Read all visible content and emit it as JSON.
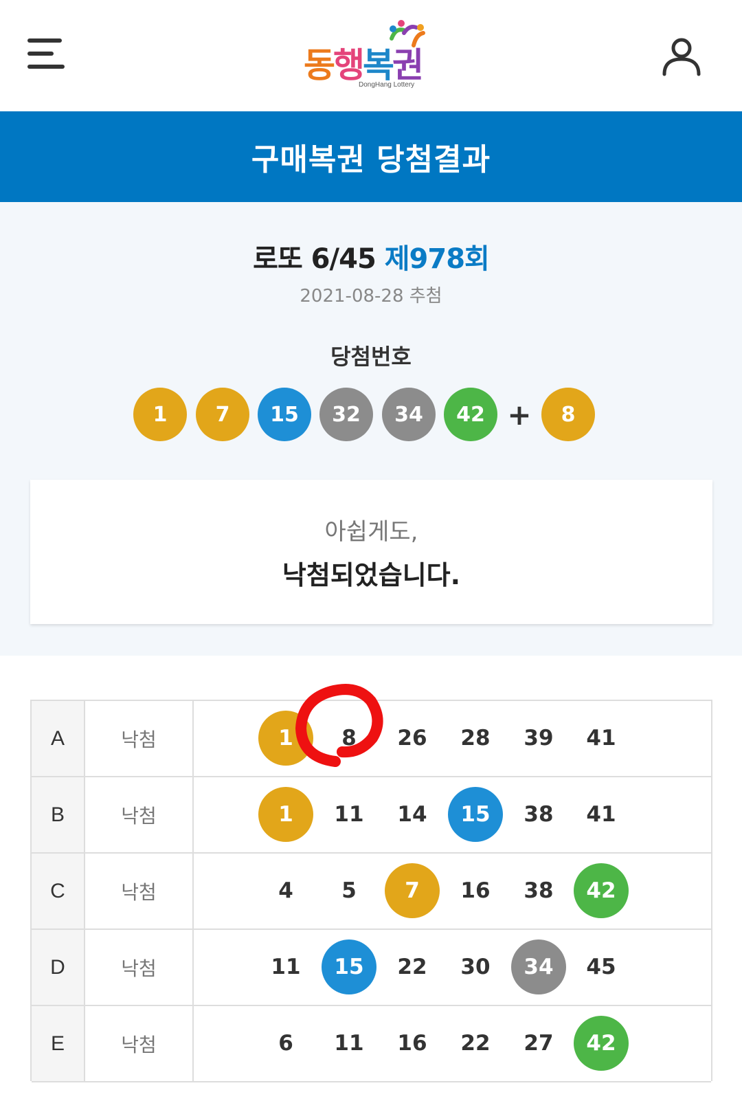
{
  "header": {
    "logo_text": [
      "동",
      "행",
      "복",
      "권"
    ],
    "logo_sub": "DongHang Lottery"
  },
  "page_title": "구매복권 당첨결과",
  "draw": {
    "game": "로또 6/45",
    "round": "제978회",
    "date": "2021-08-28 추첨",
    "win_label": "당첨번호",
    "numbers": [
      1,
      7,
      15,
      32,
      34,
      42
    ],
    "plus": "+",
    "bonus": 8
  },
  "result": {
    "line1": "아쉽게도,",
    "line2": "낙첨되었습니다."
  },
  "ball_colors": {
    "yellow": "#e2a61a",
    "blue": "#1e8fd6",
    "gray": "#8c8c8c",
    "green": "#4db647"
  },
  "ticket": {
    "rows": [
      {
        "game": "A",
        "result": "낙첨",
        "numbers": [
          1,
          8,
          26,
          28,
          39,
          41
        ]
      },
      {
        "game": "B",
        "result": "낙첨",
        "numbers": [
          1,
          11,
          14,
          15,
          38,
          41
        ]
      },
      {
        "game": "C",
        "result": "낙첨",
        "numbers": [
          4,
          5,
          7,
          16,
          38,
          42
        ]
      },
      {
        "game": "D",
        "result": "낙첨",
        "numbers": [
          11,
          15,
          22,
          30,
          34,
          45
        ]
      },
      {
        "game": "E",
        "result": "낙첨",
        "numbers": [
          6,
          11,
          16,
          22,
          27,
          42
        ]
      }
    ]
  },
  "annotation_color": "#ee1111"
}
